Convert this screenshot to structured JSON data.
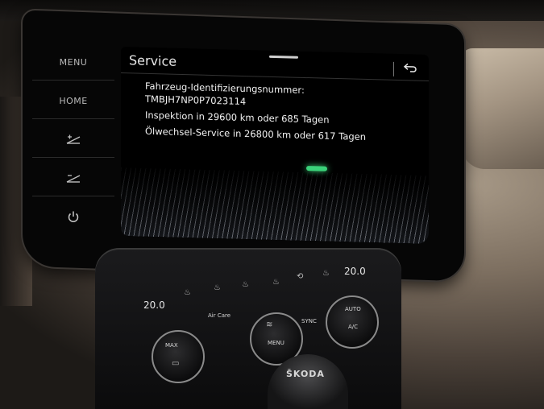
{
  "sidebar": {
    "menu_label": "MENU",
    "home_label": "HOME"
  },
  "screen": {
    "title": "Service",
    "vin_label": "Fahrzeug-Identifizierungsnummer:",
    "vin_value": "TMBJH7NP0P7023114",
    "inspection": "Inspektion in 29600 km oder 685 Tagen",
    "oil_service": "Ölwechsel-Service in 26800 km oder 617 Tagen"
  },
  "climate": {
    "temp_left": "20.0",
    "temp_right": "20.0",
    "menu_label": "MENU",
    "sync_label": "SYNC",
    "auto_label": "AUTO",
    "ac_label": "A/C",
    "max_label": "MAX",
    "air_care_label": "Air Care"
  },
  "brand": "ŠKODA",
  "icons": [
    "brightness-up-icon",
    "brightness-down-icon",
    "power-icon",
    "back-arrow-icon",
    "seat-heat-icon",
    "defrost-icon",
    "recirculation-icon"
  ]
}
